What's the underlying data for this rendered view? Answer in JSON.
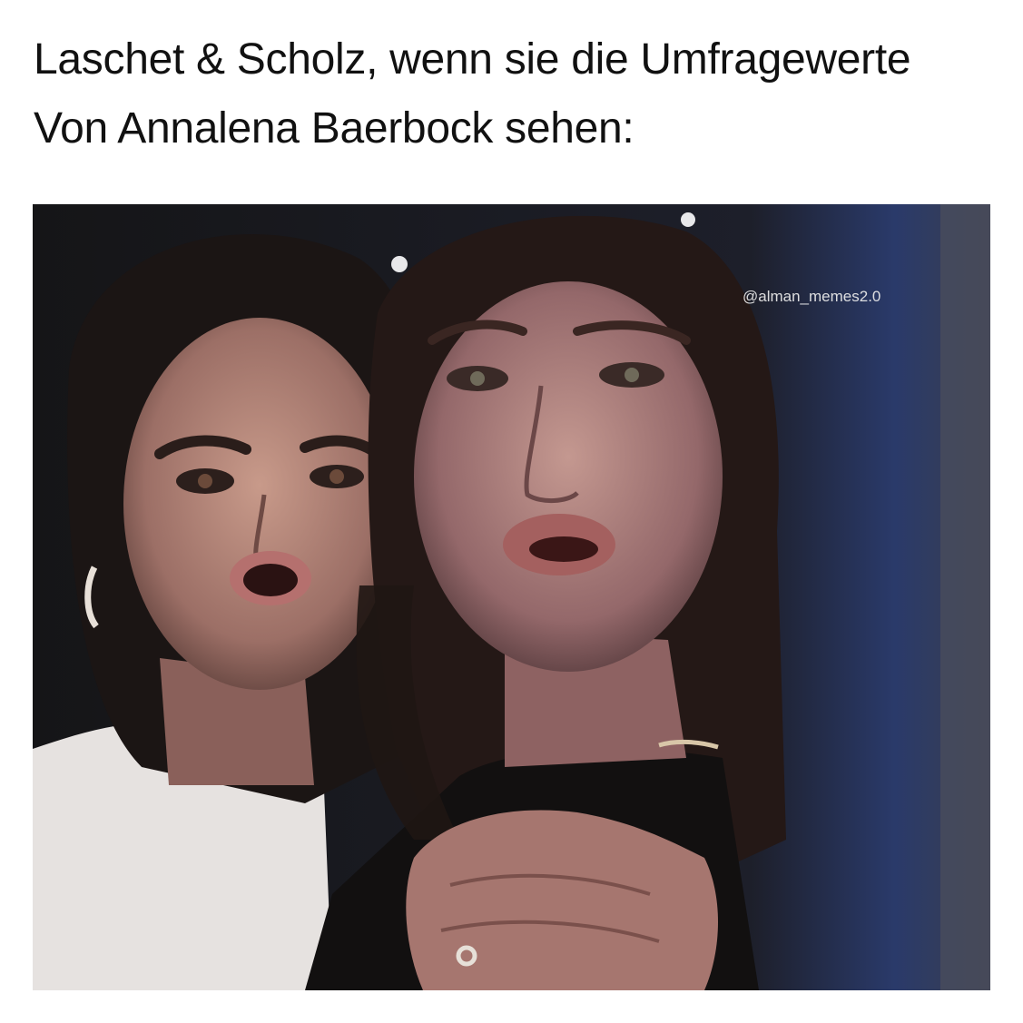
{
  "caption": {
    "line1": "Laschet & Scholz, wenn sie die Umfragewerte",
    "line2": "Von Annalena Baerbock sehen:"
  },
  "photo": {
    "watermark": "@alman_memes2.0"
  }
}
